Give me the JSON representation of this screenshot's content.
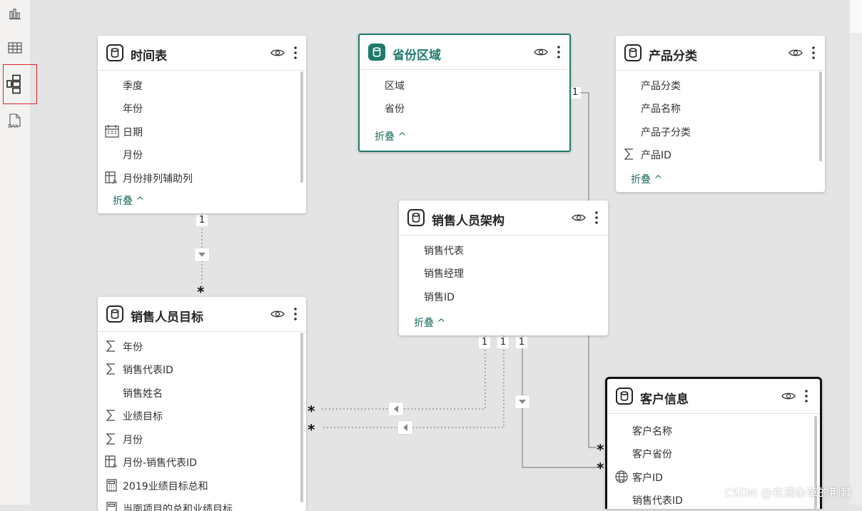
{
  "watermark": "CSDN @布满杂草的荆棘",
  "rail": {
    "icons": [
      "report-view-icon",
      "data-view-icon",
      "model-view-icon",
      "dax-query-view-icon"
    ],
    "dax_label": "DAX"
  },
  "collapse_label": "折叠 ^",
  "tables": {
    "time": {
      "title": "时间表",
      "fields": [
        "季度",
        "年份",
        "日期",
        "月份",
        "月份排列辅助列"
      ]
    },
    "region": {
      "title": "省份区域",
      "fields": [
        "区域",
        "省份"
      ]
    },
    "product": {
      "title": "产品分类",
      "fields": [
        "产品分类",
        "产品名称",
        "产品子分类",
        "产品ID"
      ]
    },
    "sales_org": {
      "title": "销售人员架构",
      "fields": [
        "销售代表",
        "销售经理",
        "销售ID"
      ]
    },
    "sales_target": {
      "title": "销售人员目标",
      "fields": [
        "年份",
        "销售代表ID",
        "销售姓名",
        "业绩目标",
        "月份",
        "月份-销售代表ID",
        "2019业绩目标总和",
        "当面项目的总和业绩目标"
      ]
    },
    "customer": {
      "title": "客户信息",
      "fields": [
        "客户名称",
        "客户省份",
        "客户ID",
        "销售代表ID"
      ]
    }
  },
  "relationships": {
    "one": "1",
    "many": "*"
  }
}
